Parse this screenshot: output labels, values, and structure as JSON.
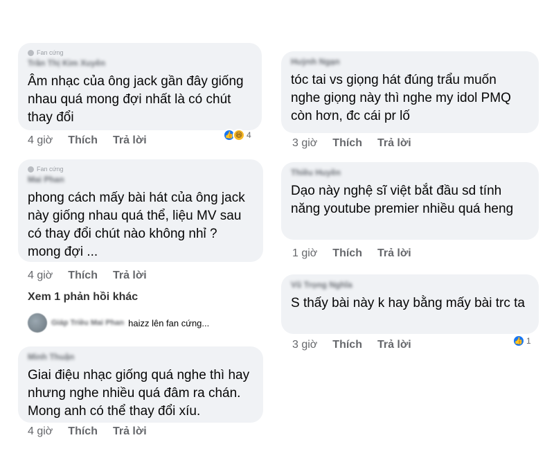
{
  "left_comments": [
    {
      "badge": "Fan cứng",
      "author": "Trần Thị Kim Xuyên",
      "text": "Âm nhạc của ông jack gần đây giống nhau quá mong đợi nhất là có chút thay đổi",
      "time": "4 giờ",
      "like_label": "Thích",
      "reply_label": "Trả lời",
      "reaction_count": "4"
    },
    {
      "badge": "Fan cứng",
      "author": "Mai Phan",
      "text": "phong cách mấy bài hát của ông jack này giống nhau quá thể, liệu MV sau có thay đổi chút nào không nhỉ ? mong đợi ...",
      "time": "4 giờ",
      "like_label": "Thích",
      "reply_label": "Trả lời"
    },
    {
      "author": "Minh Thuận",
      "text": "Giai điệu nhạc giống quá nghe thì hay nhưng nghe nhiều quá đâm ra chán. Mong anh có thể thay đổi xíu.",
      "time": "4 giờ",
      "like_label": "Thích",
      "reply_label": "Trả lời"
    }
  ],
  "more_replies": "Xem 1 phản hồi khác",
  "reply_preview": {
    "name": "Giáp Triều Mai Phan",
    "text": "haizz lên fan cứng..."
  },
  "right_comments": [
    {
      "author": "Huỳnh Ngạn",
      "text": "tóc tai vs giọng hát đúng trẩu muốn nghe giọng này thì nghe my idol PMQ còn hơn, đc cái pr lố",
      "time": "3 giờ",
      "like_label": "Thích",
      "reply_label": "Trả lời"
    },
    {
      "author": "Thiều Huyền",
      "text": "Dạo này nghệ sĩ việt bắt đầu sd tính năng youtube premier nhiều quá heng",
      "time": "1 giờ",
      "like_label": "Thích",
      "reply_label": "Trả lời"
    },
    {
      "author": "Vũ Trọng Nghĩa",
      "text": "S thấy bài này k hay bằng mấy bài trc ta",
      "time": "3 giờ",
      "like_label": "Thích",
      "reply_label": "Trả lời",
      "reaction_count": "1"
    }
  ],
  "colors": {
    "bubble": "#f0f2f5",
    "like_blue": "#1877f2",
    "haha_yellow": "#f7b928",
    "meta_gray": "#65676b"
  }
}
